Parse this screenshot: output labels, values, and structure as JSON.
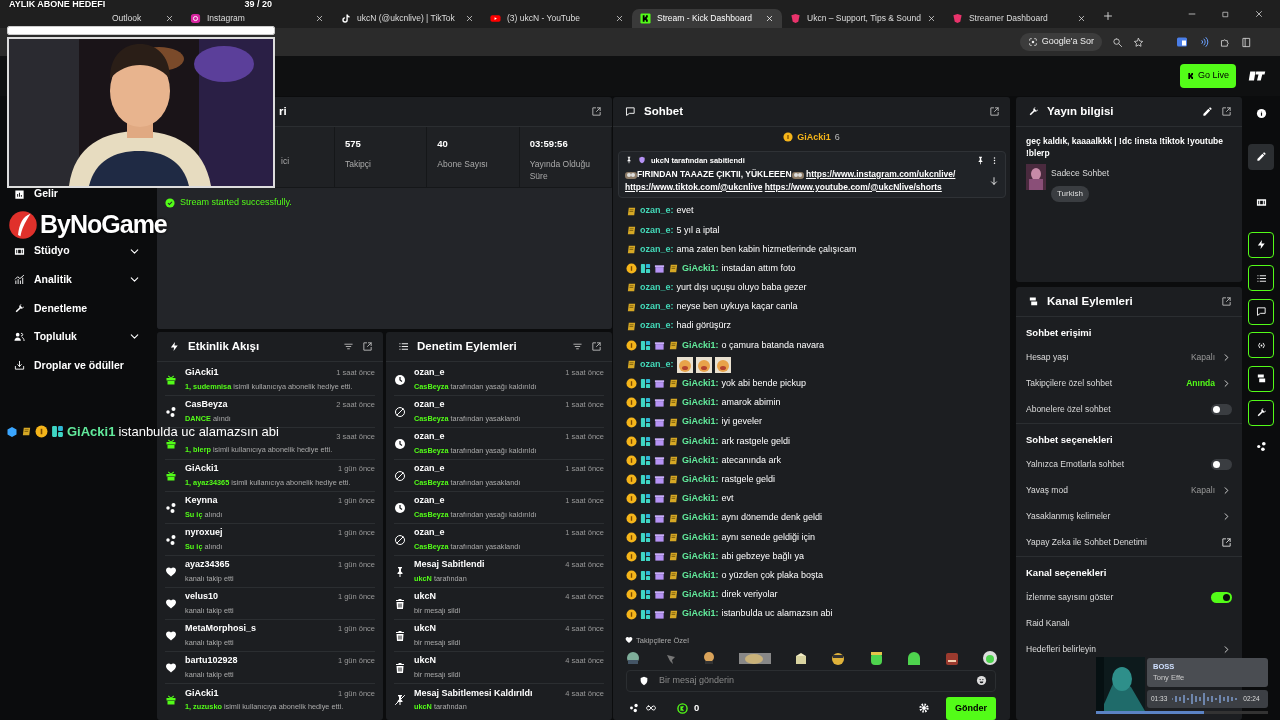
{
  "browser": {
    "tabs": [
      {
        "title": "Outlook",
        "selected": false
      },
      {
        "title": "Instagram",
        "kind": "instagram",
        "selected": false
      },
      {
        "title": "ukcN (@ukcnlive) | TikTok",
        "kind": "tiktok",
        "selected": false
      },
      {
        "title": "(3) ukcN - YouTube",
        "kind": "youtube",
        "selected": false
      },
      {
        "title": "Stream - Kick Dashboard",
        "kind": "kick",
        "selected": true
      },
      {
        "title": "Ukcn – Support, Tips & Sound",
        "kind": "kickpink",
        "selected": false
      },
      {
        "title": "Streamer Dashboard",
        "kind": "kickpink",
        "selected": false
      }
    ],
    "ask_button": "Google'a Sor"
  },
  "go_live": "Go Live",
  "sidebar": {
    "items": [
      {
        "label": "Gelir",
        "kind": "revenue",
        "expandable": false
      },
      {
        "label": "Stüdyo",
        "kind": "film",
        "expandable": true
      },
      {
        "label": "Analitik",
        "kind": "analytics",
        "expandable": true
      },
      {
        "label": "Denetleme",
        "kind": "wrench",
        "expandable": false
      },
      {
        "label": "Topluluk",
        "kind": "community",
        "expandable": true
      },
      {
        "label": "Droplar ve ödüller",
        "kind": "dropsbox",
        "expandable": false
      }
    ]
  },
  "stats_panel": {
    "title": "ri",
    "stats": [
      {
        "label": "ici"
      },
      {
        "value": "575",
        "label": "Takipçi"
      },
      {
        "value": "40",
        "label": "Abone Sayısı"
      },
      {
        "value": "03:59:56",
        "label": "Yayında Olduğu Süre"
      }
    ],
    "alert": "Stream started successfully."
  },
  "activity_feed": {
    "title": "Etkinlik Akışı",
    "events": [
      {
        "kind": "gift",
        "user": "GiAcki1",
        "time": "1 saat önce",
        "highlight": "1, sudemnisa",
        "detail": "isimli kullanıcıya abonelik hediye etti."
      },
      {
        "kind": "drop",
        "user": "CasBeyza",
        "time": "2 saat önce",
        "highlight": "DANCE",
        "detail": "alındı"
      },
      {
        "kind": "gift",
        "time": "3 saat önce",
        "highlight": "1, blerp",
        "detail": "isimli kullanıcıya abonelik hediye etti."
      },
      {
        "kind": "gift",
        "user": "GiAcki1",
        "time": "1 gün önce",
        "highlight": "1, ayaz34365",
        "detail": "isimli kullanıcıya abonelik hediye etti."
      },
      {
        "kind": "drop",
        "user": "Keynna",
        "time": "1 gün önce",
        "highlight": "Su iç",
        "detail": "alındı"
      },
      {
        "kind": "drop",
        "user": "nyroxuej",
        "time": "1 gün önce",
        "highlight": "Su iç",
        "detail": "alındı"
      },
      {
        "kind": "follow",
        "user": "ayaz34365",
        "time": "1 gün önce",
        "detail": "kanalı takip etti"
      },
      {
        "kind": "follow",
        "user": "velus10",
        "time": "1 gün önce",
        "detail": "kanalı takip etti"
      },
      {
        "kind": "follow",
        "user": "MetaMorphosi_s",
        "time": "1 gün önce",
        "detail": "kanalı takip etti"
      },
      {
        "kind": "follow",
        "user": "bartu102928",
        "time": "1 gün önce",
        "detail": "kanalı takip etti"
      },
      {
        "kind": "gift",
        "user": "GiAcki1",
        "time": "1 gün önce",
        "highlight": "1, zuzusko",
        "detail": "isimli kullanıcıya abonelik hediye etti."
      }
    ]
  },
  "moderation": {
    "title": "Denetim Eylemleri",
    "actions": [
      {
        "kind": "unban",
        "title": "ozan_e",
        "time": "1 saat önce",
        "highlight": "CasBeyza",
        "detail": "tarafından yasağı kaldırıldı"
      },
      {
        "kind": "ban",
        "title": "ozan_e",
        "time": "1 saat önce",
        "highlight": "CasBeyza",
        "detail": "tarafından yasaklandı"
      },
      {
        "kind": "unban",
        "title": "ozan_e",
        "time": "1 saat önce",
        "highlight": "CasBeyza",
        "detail": "tarafından yasağı kaldırıldı"
      },
      {
        "kind": "ban",
        "title": "ozan_e",
        "time": "1 saat önce",
        "highlight": "CasBeyza",
        "detail": "tarafından yasaklandı"
      },
      {
        "kind": "unban",
        "title": "ozan_e",
        "time": "1 saat önce",
        "highlight": "CasBeyza",
        "detail": "tarafından yasağı kaldırıldı"
      },
      {
        "kind": "ban",
        "title": "ozan_e",
        "time": "1 saat önce",
        "highlight": "CasBeyza",
        "detail": "tarafından yasaklandı"
      },
      {
        "kind": "pin",
        "title": "Mesaj Sabitlendi",
        "time": "4 saat önce",
        "highlight": "ukcN",
        "detail": "tarafından"
      },
      {
        "kind": "delete",
        "title": "ukcN",
        "time": "4 saat önce",
        "detail": "bir mesajı sildi"
      },
      {
        "kind": "delete",
        "title": "ukcN",
        "time": "4 saat önce",
        "detail": "bir mesajı sildi"
      },
      {
        "kind": "delete",
        "title": "ukcN",
        "time": "4 saat önce",
        "detail": "bir mesajı sildi"
      },
      {
        "kind": "unpin",
        "title": "Mesaj Sabitlemesi Kaldırıldı",
        "time": "4 saat önce",
        "highlight": "ukcN",
        "detail": "tarafından"
      }
    ]
  },
  "chat": {
    "title": "Sohbet",
    "top_gifter": {
      "user": "GiAcki1",
      "count": "6"
    },
    "pinned": {
      "label": "ukcN tarafından sabitlendi",
      "text": "FIRINDAN TAAAZE ÇIKTII, YÜKLEEEN",
      "links": [
        "https://www.instagram.com/ukcnlive/",
        "https://www.tiktok.com/@ukcnlive",
        "https://www.youtube.com/@ukcNlive/shorts"
      ]
    },
    "messages": [
      {
        "kind": "viewer",
        "user": "ozan_e:",
        "color": "#43d9b8",
        "text": "evet"
      },
      {
        "kind": "viewer",
        "user": "ozan_e:",
        "color": "#43d9b8",
        "text": "5 yıl a iptal"
      },
      {
        "kind": "viewer",
        "user": "ozan_e:",
        "color": "#43d9b8",
        "text": "ama zaten ben kabin hizmetlerinde çalışıcam"
      },
      {
        "kind": "supporter",
        "user": "GiAcki1:",
        "color": "#62eb9c",
        "text": "instadan attım foto"
      },
      {
        "kind": "viewer",
        "user": "ozan_e:",
        "color": "#43d9b8",
        "text": "yurt dışı uçuşu oluyo baba gezer"
      },
      {
        "kind": "viewer",
        "user": "ozan_e:",
        "color": "#43d9b8",
        "text": "neyse ben uykuya kaçar canla"
      },
      {
        "kind": "viewer",
        "user": "ozan_e:",
        "color": "#43d9b8",
        "text": "hadi görüşürz"
      },
      {
        "kind": "supporter",
        "user": "GiAcki1:",
        "color": "#62eb9c",
        "text": "o çamura batanda navara"
      },
      {
        "kind": "viewer",
        "user": "ozan_e:",
        "color": "#43d9b8"
      },
      {
        "kind": "supporter",
        "user": "GiAcki1:",
        "color": "#62eb9c",
        "text": "yok abi bende pickup"
      },
      {
        "kind": "supporter",
        "user": "GiAcki1:",
        "color": "#62eb9c",
        "text": "amarok abimin"
      },
      {
        "kind": "supporter",
        "user": "GiAcki1:",
        "color": "#62eb9c",
        "text": "iyi geveler"
      },
      {
        "kind": "supporter",
        "user": "GiAcki1:",
        "color": "#62eb9c",
        "text": "ark rastgele geldi"
      },
      {
        "kind": "supporter",
        "user": "GiAcki1:",
        "color": "#62eb9c",
        "text": "atecanında ark"
      },
      {
        "kind": "supporter",
        "user": "GiAcki1:",
        "color": "#62eb9c",
        "text": "rastgele geldi"
      },
      {
        "kind": "supporter",
        "user": "GiAcki1:",
        "color": "#62eb9c",
        "text": "evt"
      },
      {
        "kind": "supporter",
        "user": "GiAcki1:",
        "color": "#62eb9c",
        "text": "aynı dönemde denk geldi"
      },
      {
        "kind": "supporter",
        "user": "GiAcki1:",
        "color": "#62eb9c",
        "text": "aynı senede geldiği için"
      },
      {
        "kind": "supporter",
        "user": "GiAcki1:",
        "color": "#62eb9c",
        "text": "abi gebzeye bağlı ya"
      },
      {
        "kind": "supporter",
        "user": "GiAcki1:",
        "color": "#62eb9c",
        "text": "o yüzden çok plaka boşta"
      },
      {
        "kind": "supporter",
        "user": "GiAcki1:",
        "color": "#62eb9c",
        "text": "direk veriyolar"
      },
      {
        "kind": "supporter",
        "user": "GiAcki1:",
        "color": "#62eb9c",
        "text": "istanbulda uc alamazsın abi"
      }
    ],
    "emote_label": "Takipçilere Özel",
    "placeholder": "Bir mesaj gönderin",
    "points": "0",
    "send": "Gönder"
  },
  "stream_info": {
    "title": "Yayın bilgisi",
    "stream_title": "geç kaldık, kaaaalkkk | !dc !insta !tiktok !youtube !blerp",
    "category": "Sadece Sohbet",
    "tags": [
      "Turkish"
    ]
  },
  "channel_actions": {
    "title": "Kanal Eylemleri",
    "sections": [
      {
        "heading": "Sohbet erişimi",
        "rows": [
          {
            "kind": "value",
            "label": "Hesap yaşı",
            "value": "Kapalı",
            "highlighted": false
          },
          {
            "kind": "value",
            "label": "Takipçilere özel sohbet",
            "value": "Anında",
            "highlighted": true
          },
          {
            "kind": "toggle",
            "label": "Abonelere özel sohbet",
            "on": false
          }
        ]
      },
      {
        "heading": "Sohbet seçenekleri",
        "rows": [
          {
            "kind": "toggle",
            "label": "Yalnızca Emotlarla sohbet",
            "on": false
          },
          {
            "kind": "value",
            "label": "Yavaş mod",
            "value": "Kapalı",
            "highlighted": false
          },
          {
            "kind": "link",
            "label": "Yasaklanmış kelimeler"
          },
          {
            "kind": "external",
            "label": "Yapay Zeka ile Sohbet Denetimi"
          }
        ]
      },
      {
        "heading": "Kanal seçenekleri",
        "rows": [
          {
            "kind": "toggle",
            "label": "İzlenme sayısını göster",
            "on": true
          },
          {
            "kind": "plain",
            "label": "Raid Kanalı"
          },
          {
            "kind": "link",
            "label": "Hedefleri belirleyin"
          }
        ]
      }
    ]
  },
  "rail": [
    {
      "kind": "info",
      "selected": false,
      "pinned": false
    },
    {
      "kind": "pencil",
      "selected": true,
      "pinned": false
    },
    {
      "kind": "film",
      "selected": false,
      "pinned": false
    },
    {
      "kind": "bolt",
      "selected": false,
      "pinned": true
    },
    {
      "kind": "list",
      "selected": false,
      "pinned": true
    },
    {
      "kind": "chat",
      "selected": false,
      "pinned": true
    },
    {
      "kind": "broadcast",
      "selected": false,
      "pinned": true
    },
    {
      "kind": "stack",
      "selected": false,
      "pinned": true
    },
    {
      "kind": "wrench",
      "selected": false,
      "pinned": true
    },
    {
      "kind": "drops",
      "selected": false,
      "pinned": false
    }
  ],
  "overlays": {
    "goal": {
      "title": "AYLIK ABONE HEDEFİ",
      "count": "39 / 20",
      "level": 1
    },
    "logo": "ByNoGame",
    "chat_line": {
      "user": "GiAcki1",
      "text": "istanbulda uc alamazsın abi"
    },
    "music": {
      "title": "BOSS",
      "artist": "Tony Effe",
      "elapsed": "01:33",
      "total": "02:24",
      "level": 0.63
    }
  }
}
